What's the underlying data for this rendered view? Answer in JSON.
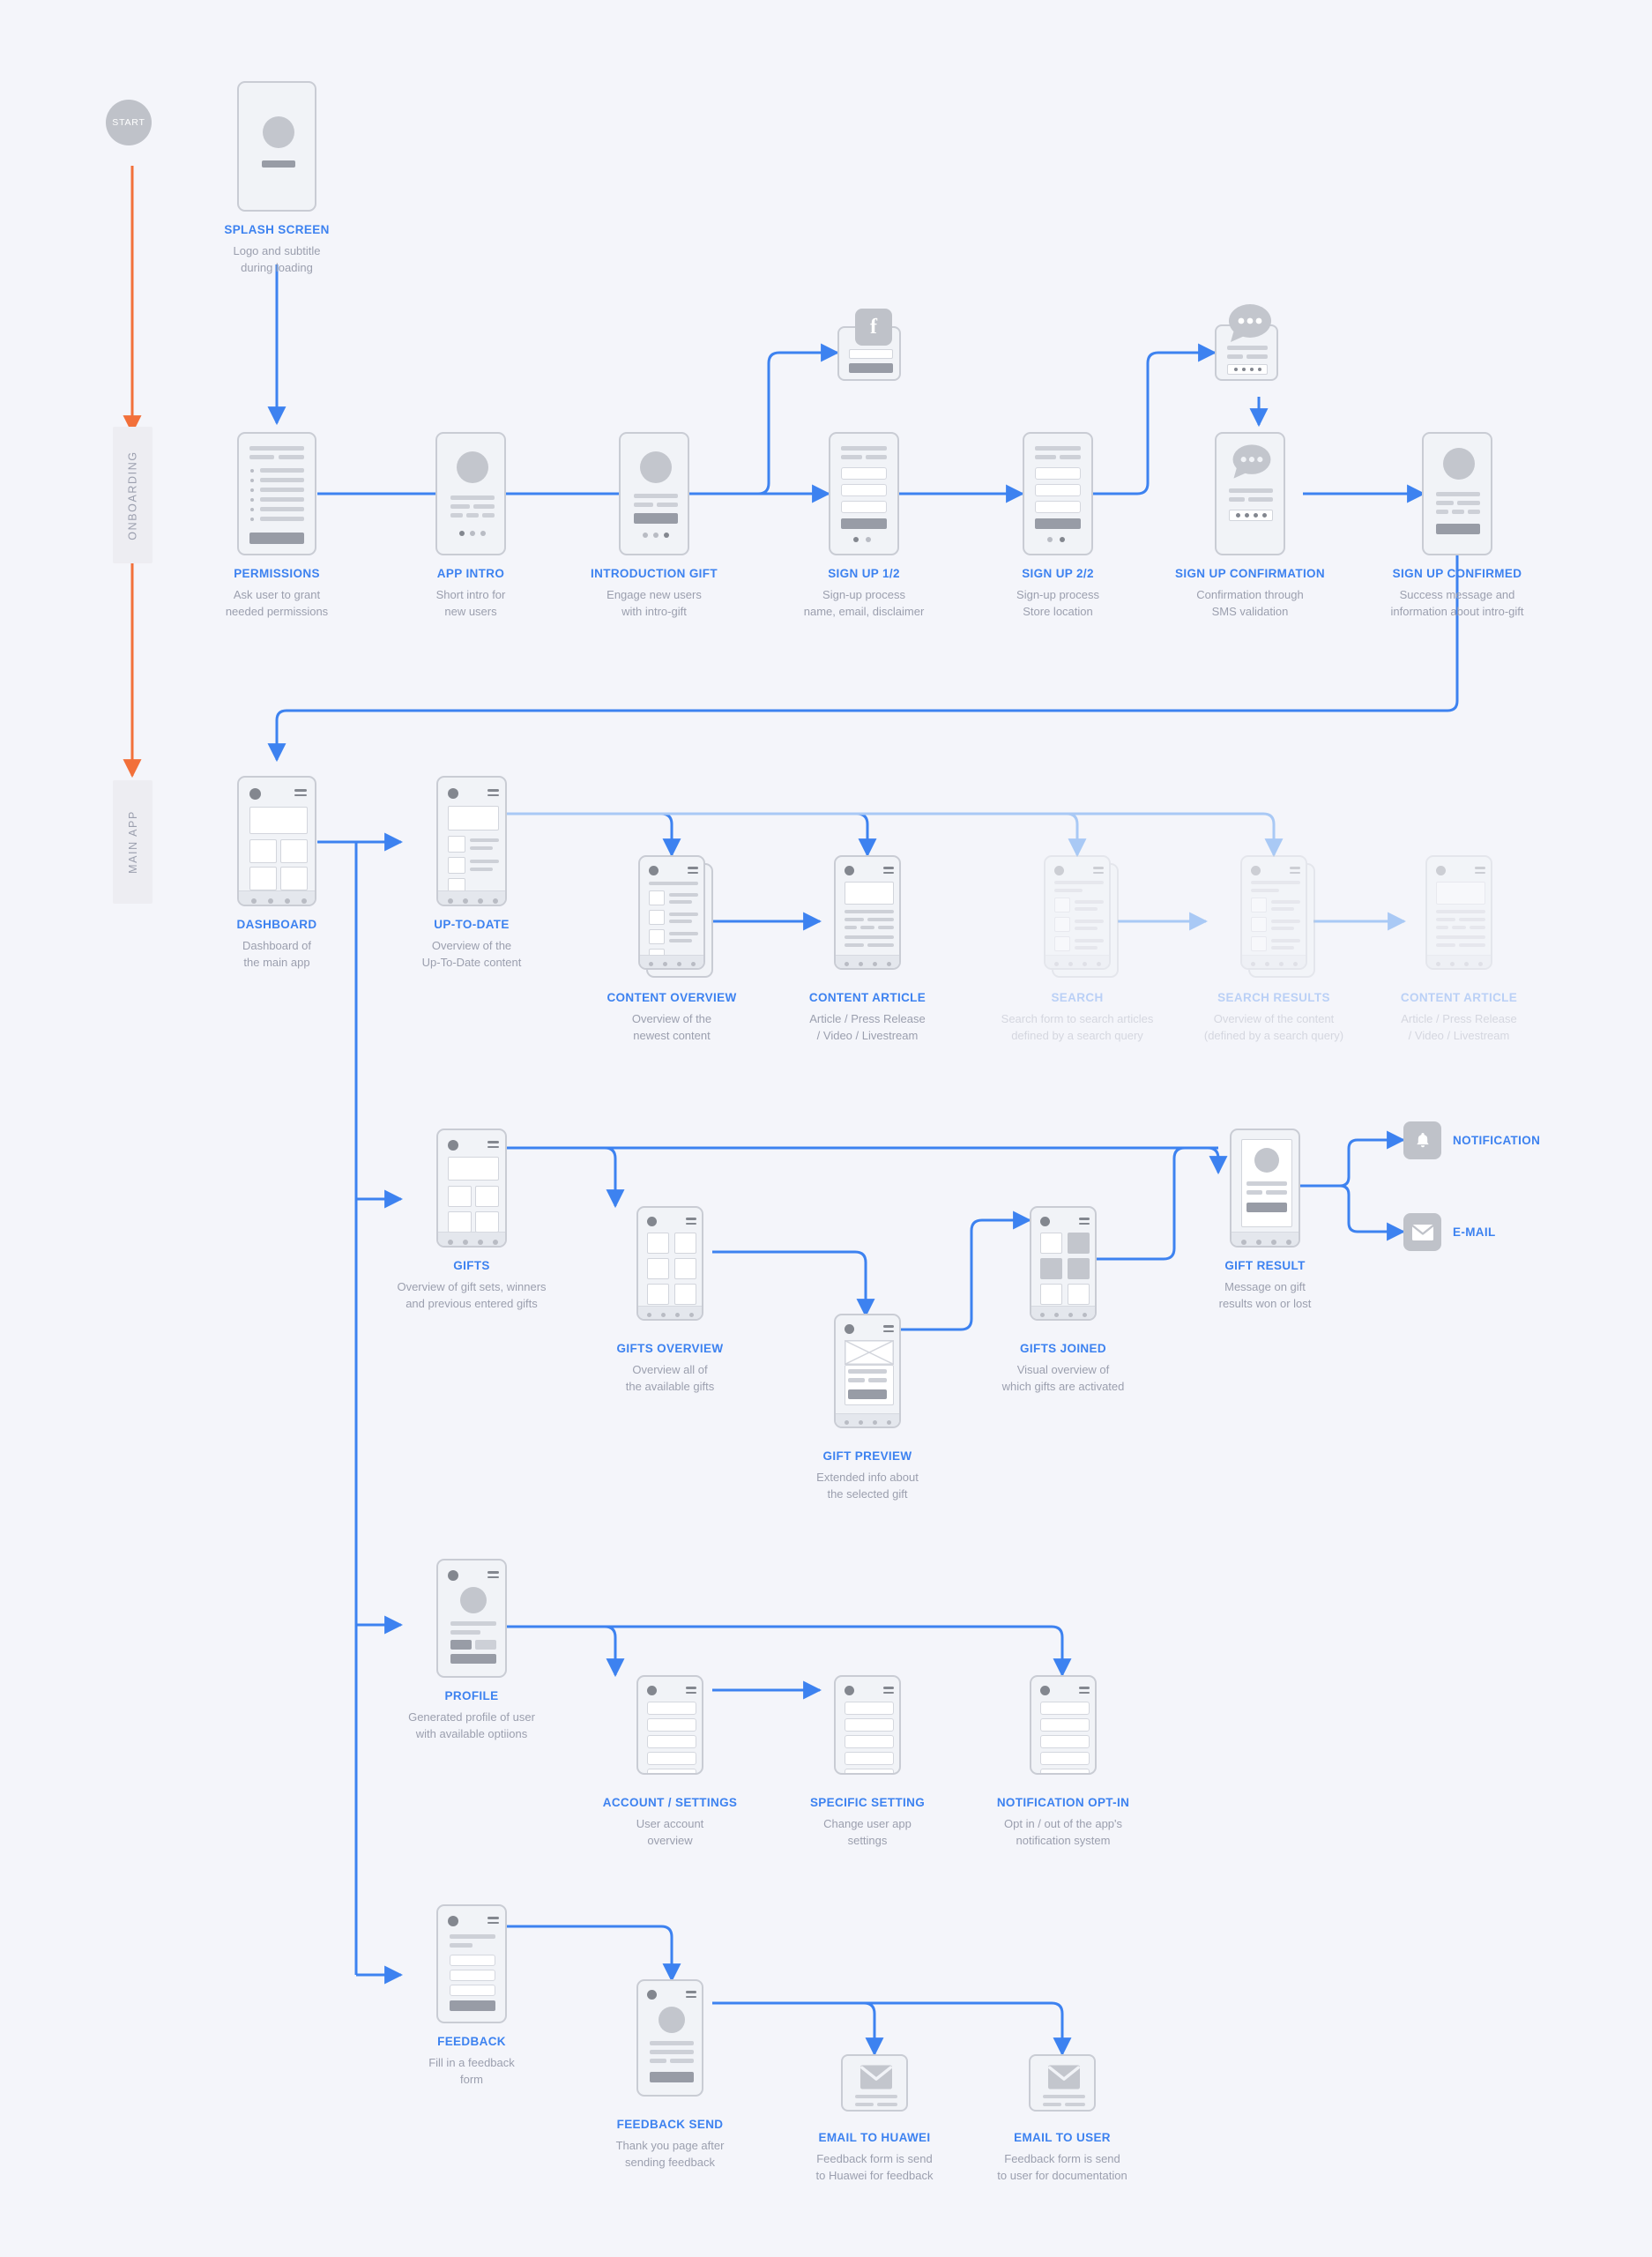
{
  "diagram": {
    "title": "Mobile App User Flow",
    "start_label": "START",
    "lanes": [
      {
        "id": "onboarding",
        "label": "ONBOARDING"
      },
      {
        "id": "main-app",
        "label": "MAIN APP"
      }
    ],
    "colors": {
      "background": "#f4f5fa",
      "accent_blue": "#3d82f0",
      "wire_blue": "#3d82f0",
      "wire_blue_faded": "#a9c9f5",
      "start_orange": "#f2703a",
      "title_blue": "#3d82f0",
      "caption_grey": "#9b9fae",
      "frame_grey": "#c9ccd4",
      "fill_grey": "#c3c6cd",
      "dark_grey": "#989ca6"
    }
  },
  "nodes": [
    {
      "id": "splash-screen",
      "title": "SPLASH SCREEN",
      "desc": [
        "Logo and subtitle",
        "during loading"
      ],
      "icon": "phone-splash"
    },
    {
      "id": "permissions",
      "title": "PERMISSIONS",
      "desc": [
        "Ask user to grant",
        "needed permissions"
      ],
      "icon": "phone-permission-list"
    },
    {
      "id": "app-intro",
      "title": "APP INTRO",
      "desc": [
        "Short intro for",
        "new users"
      ],
      "icon": "phone-intro-carousel"
    },
    {
      "id": "introduction-gift",
      "title": "INTRODUCTION GIFT",
      "desc": [
        "Engage new users",
        "with intro-gift"
      ],
      "icon": "phone-intro-gift"
    },
    {
      "id": "facebook-signup",
      "title": "",
      "desc": [],
      "icon": "facebook-card"
    },
    {
      "id": "sign-up-1",
      "title": "SIGN UP 1/2",
      "desc": [
        "Sign-up process",
        "name, email, disclaimer"
      ],
      "icon": "phone-form-3field"
    },
    {
      "id": "sign-up-2",
      "title": "SIGN UP 2/2",
      "desc": [
        "Sign-up process",
        "Store location"
      ],
      "icon": "phone-form-3field"
    },
    {
      "id": "sms-card",
      "title": "",
      "desc": [],
      "icon": "sms-bubble-card"
    },
    {
      "id": "sign-up-confirmation",
      "title": "SIGN UP CONFIRMATION",
      "desc": [
        "Confirmation through",
        "SMS validation"
      ],
      "icon": "phone-sms-validate"
    },
    {
      "id": "sign-up-confirmed",
      "title": "SIGN UP CONFIRMED",
      "desc": [
        "Success message and",
        "information about intro-gift"
      ],
      "icon": "phone-success"
    },
    {
      "id": "dashboard",
      "title": "DASHBOARD",
      "desc": [
        "Dashboard of",
        "the main app"
      ],
      "icon": "phone-dashboard-grid"
    },
    {
      "id": "up-to-date",
      "title": "UP-TO-DATE",
      "desc": [
        "Overview of the",
        "Up-To-Date content"
      ],
      "icon": "phone-uptodate-list"
    },
    {
      "id": "content-overview",
      "title": "CONTENT OVERVIEW",
      "desc": [
        "Overview of the",
        "newest content"
      ],
      "icon": "phone-content-list-stack"
    },
    {
      "id": "content-article",
      "title": "CONTENT ARTICLE",
      "desc": [
        "Article / Press Release",
        "/ Video / Livestream"
      ],
      "icon": "phone-article"
    },
    {
      "id": "search",
      "title": "SEARCH",
      "desc": [
        "Search form to search articles",
        "defined by a search query"
      ],
      "icon": "phone-content-list-stack",
      "faded": true
    },
    {
      "id": "search-results",
      "title": "SEARCH RESULTS",
      "desc": [
        "Overview of the content",
        "(defined by a search query)"
      ],
      "icon": "phone-content-list-stack",
      "faded": true
    },
    {
      "id": "content-article-2",
      "title": "CONTENT ARTICLE",
      "desc": [
        "Article / Press Release",
        "/ Video / Livestream"
      ],
      "icon": "phone-article",
      "faded": true
    },
    {
      "id": "gifts",
      "title": "GIFTS",
      "desc": [
        "Overview of gift sets, winners",
        "and previous entered gifts"
      ],
      "icon": "phone-dashboard-grid"
    },
    {
      "id": "gifts-overview",
      "title": "GIFTS OVERVIEW",
      "desc": [
        "Overview all of",
        "the available gifts"
      ],
      "icon": "phone-gift-grid"
    },
    {
      "id": "gift-preview",
      "title": "GIFT PREVIEW",
      "desc": [
        "Extended info about",
        "the selected gift"
      ],
      "icon": "phone-gift-preview"
    },
    {
      "id": "gifts-joined",
      "title": "GIFTS JOINED",
      "desc": [
        "Visual overview of",
        "which gifts are activated"
      ],
      "icon": "phone-gift-grid-joined"
    },
    {
      "id": "gift-result",
      "title": "GIFT RESULT",
      "desc": [
        "Message on gift",
        "results won or lost"
      ],
      "icon": "phone-gift-result"
    },
    {
      "id": "notification",
      "title": "NOTIFICATION",
      "desc": [],
      "icon": "bell-tile"
    },
    {
      "id": "e-mail",
      "title": "E-MAIL",
      "desc": [],
      "icon": "envelope-tile"
    },
    {
      "id": "profile",
      "title": "PROFILE",
      "desc": [
        "Generated profile of user",
        "with available optiions"
      ],
      "icon": "phone-profile"
    },
    {
      "id": "account-settings",
      "title": "ACCOUNT / SETTINGS",
      "desc": [
        "User account",
        "overview"
      ],
      "icon": "phone-settings-rows"
    },
    {
      "id": "specific-setting",
      "title": "SPECIFIC SETTING",
      "desc": [
        "Change user app",
        "settings"
      ],
      "icon": "phone-settings-rows"
    },
    {
      "id": "notification-opt-in",
      "title": "NOTIFICATION OPT-IN",
      "desc": [
        "Opt in / out of the app's",
        "notification system"
      ],
      "icon": "phone-settings-rows"
    },
    {
      "id": "feedback",
      "title": "FEEDBACK",
      "desc": [
        "Fill in a feedback",
        "form"
      ],
      "icon": "phone-feedback-form"
    },
    {
      "id": "feedback-send",
      "title": "FEEDBACK SEND",
      "desc": [
        "Thank you page after",
        "sending feedback"
      ],
      "icon": "phone-success"
    },
    {
      "id": "email-to-huawei",
      "title": "EMAIL TO HUAWEI",
      "desc": [
        "Feedback form is send",
        "to Huawei for feedback"
      ],
      "icon": "envelope-card"
    },
    {
      "id": "email-to-user",
      "title": "EMAIL TO USER",
      "desc": [
        "Feedback form is send",
        "to user for documentation"
      ],
      "icon": "envelope-card"
    }
  ]
}
